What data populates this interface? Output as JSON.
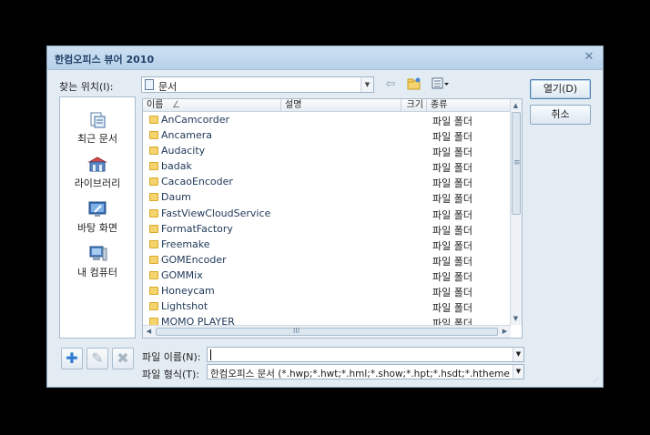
{
  "window": {
    "title": "한컴오피스 뷰어 2010"
  },
  "location": {
    "label": "찾는 위치(I):",
    "value": "문서"
  },
  "buttons": {
    "open": "열기(D)",
    "cancel": "취소"
  },
  "places": [
    {
      "label": "최근 문서",
      "icon": "recent-docs-icon"
    },
    {
      "label": "라이브러리",
      "icon": "library-icon"
    },
    {
      "label": "바탕 화면",
      "icon": "desktop-icon"
    },
    {
      "label": "내 컴퓨터",
      "icon": "computer-icon"
    }
  ],
  "columns": {
    "name": "이름",
    "sort_indicator": "∠",
    "description": "설명",
    "size": "크기",
    "type": "종류"
  },
  "files": [
    {
      "name": "AnCamcorder",
      "type": "파일 폴더"
    },
    {
      "name": "Ancamera",
      "type": "파일 폴더"
    },
    {
      "name": "Audacity",
      "type": "파일 폴더"
    },
    {
      "name": "badak",
      "type": "파일 폴더"
    },
    {
      "name": "CacaoEncoder",
      "type": "파일 폴더"
    },
    {
      "name": "Daum",
      "type": "파일 폴더"
    },
    {
      "name": "FastViewCloudService",
      "type": "파일 폴더"
    },
    {
      "name": "FormatFactory",
      "type": "파일 폴더"
    },
    {
      "name": "Freemake",
      "type": "파일 폴더"
    },
    {
      "name": "GOMEncoder",
      "type": "파일 폴더"
    },
    {
      "name": "GOMMix",
      "type": "파일 폴더"
    },
    {
      "name": "Honeycam",
      "type": "파일 폴더"
    },
    {
      "name": "Lightshot",
      "type": "파일 폴더"
    },
    {
      "name": "MOMO PLAYER",
      "type": "파일 폴더"
    }
  ],
  "filename": {
    "label": "파일 이름(N):",
    "value": ""
  },
  "filetype": {
    "label": "파일 형식(T):",
    "value": "한컴오피스 문서 (*.hwp;*.hwt;*.hml;*.show;*.hpt;*.hsdt;*.htheme;*.cell;*.nxl;*.cht)"
  },
  "scroll_glyph": "≡",
  "hscroll_glyph": "III"
}
